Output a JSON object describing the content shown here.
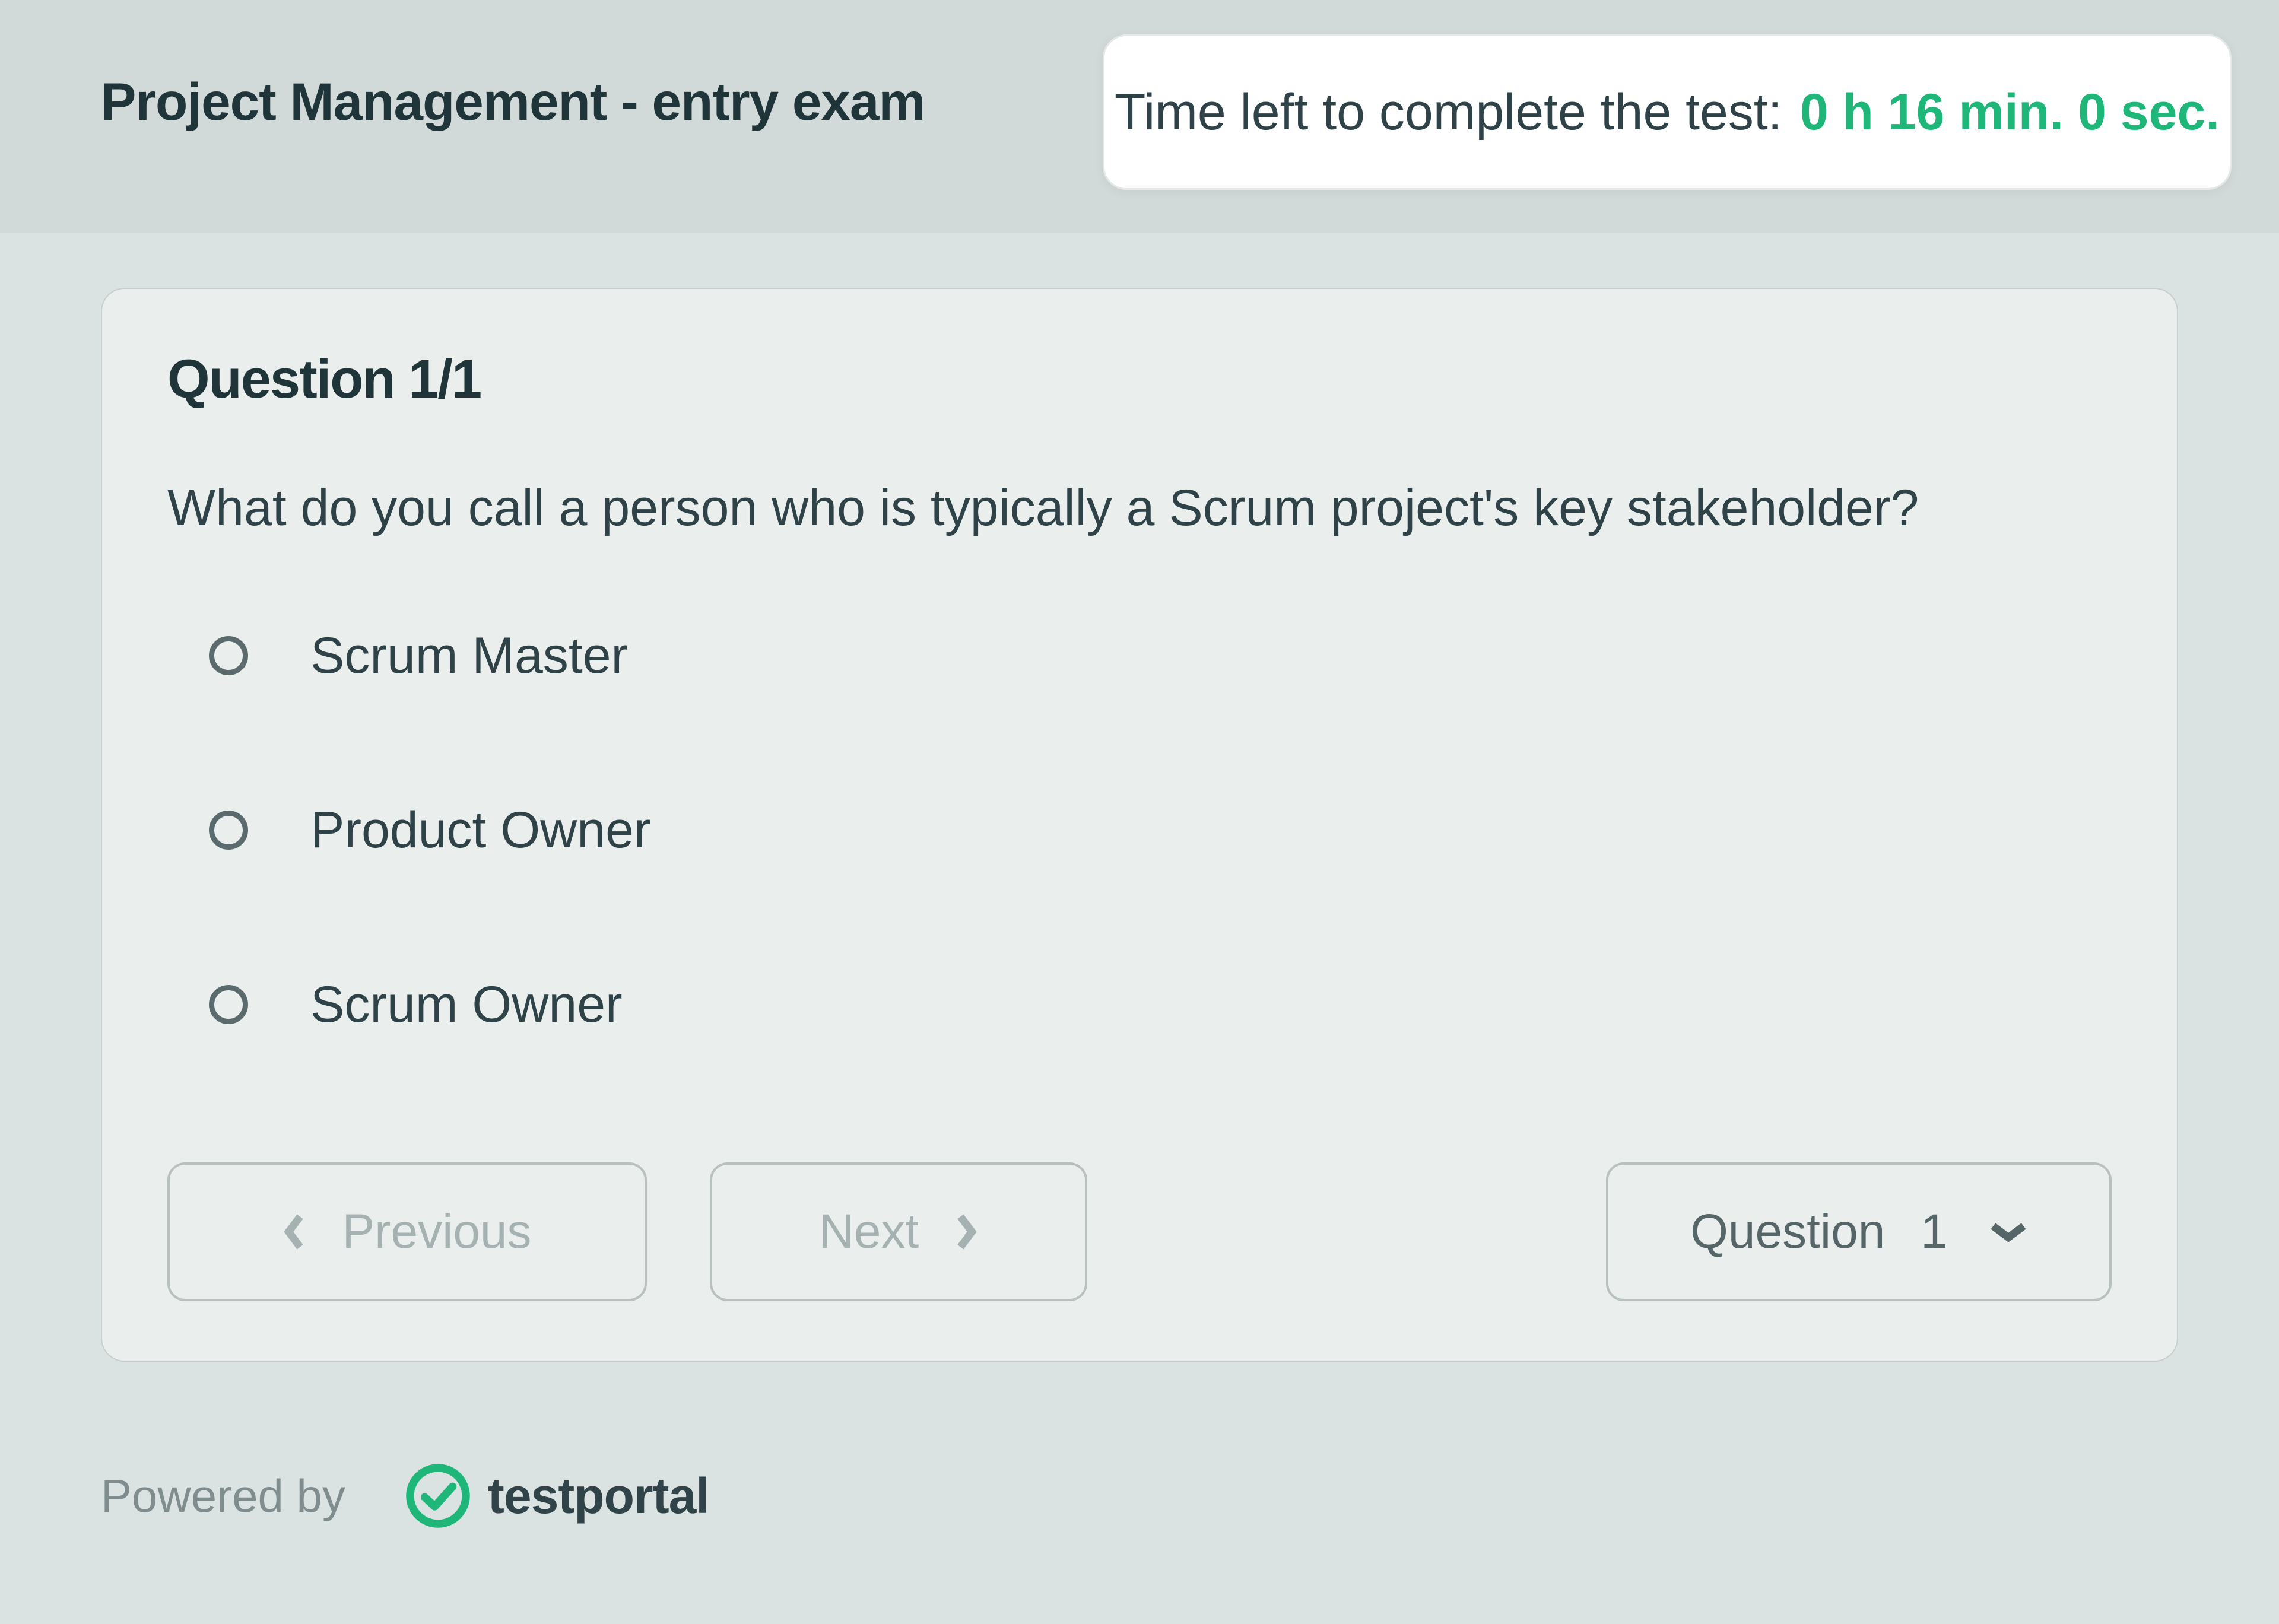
{
  "header": {
    "exam_title": "Project Management - entry exam",
    "timer_label": "Time left to complete the test:",
    "timer_value": "0 h 16 min. 0 sec."
  },
  "question": {
    "index": 1,
    "total": 1,
    "heading": "Question 1/1",
    "text": "What do you call a person who is typically a Scrum project's key stakeholder?",
    "options": [
      {
        "label": "Scrum Master",
        "selected": false
      },
      {
        "label": "Product Owner",
        "selected": false
      },
      {
        "label": "Scrum Owner",
        "selected": false
      }
    ]
  },
  "nav": {
    "previous_label": "Previous",
    "next_label": "Next",
    "dropdown": {
      "word": "Question",
      "value": "1"
    }
  },
  "footer": {
    "powered_by": "Powered by",
    "brand": "testportal"
  },
  "colors": {
    "accent_green": "#1fb67a"
  }
}
